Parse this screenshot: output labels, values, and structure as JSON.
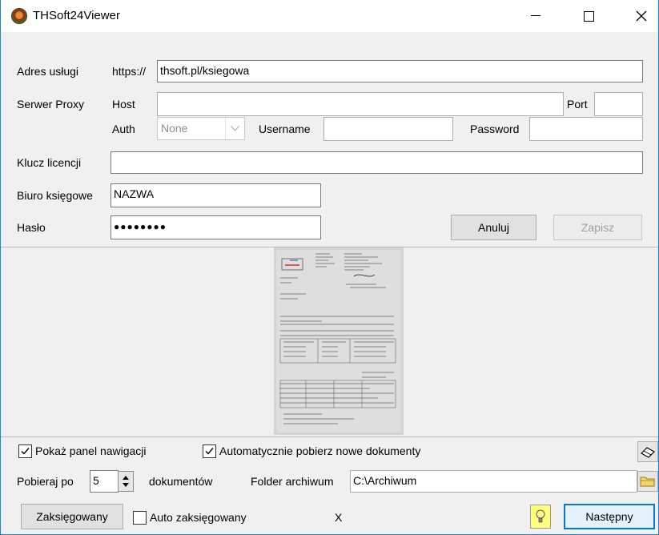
{
  "window": {
    "title": "THSoft24Viewer"
  },
  "service": {
    "label": "Adres usługi",
    "prefix": "https://",
    "value": "thsoft.pl/ksiegowa"
  },
  "proxy": {
    "label": "Serwer Proxy",
    "host_label": "Host",
    "host_value": "",
    "port_label": "Port",
    "port_value": "",
    "auth_label": "Auth",
    "auth_value": "None",
    "username_label": "Username",
    "username_value": "",
    "password_label": "Password",
    "password_value": ""
  },
  "license": {
    "label": "Klucz licencji",
    "value": ""
  },
  "office": {
    "label": "Biuro księgowe",
    "value": "NAZWA"
  },
  "password": {
    "label": "Hasło",
    "value": "●●●●●●●●"
  },
  "buttons": {
    "cancel": "Anuluj",
    "save": "Zapisz",
    "booked": "Zaksięgowany",
    "next": "Następny"
  },
  "options": {
    "show_nav_label": "Pokaż panel nawigacji",
    "show_nav_checked": true,
    "auto_download_label": "Automatycznie pobierz nowe dokumenty",
    "auto_download_checked": true,
    "fetch_label": "Pobieraj po",
    "fetch_value": "5",
    "fetch_suffix": "dokumentów",
    "archive_label": "Folder archiwum",
    "archive_value": "C:\\Archiwum",
    "auto_book_label": "Auto zaksięgowany",
    "auto_book_checked": false,
    "status_x": "X"
  }
}
